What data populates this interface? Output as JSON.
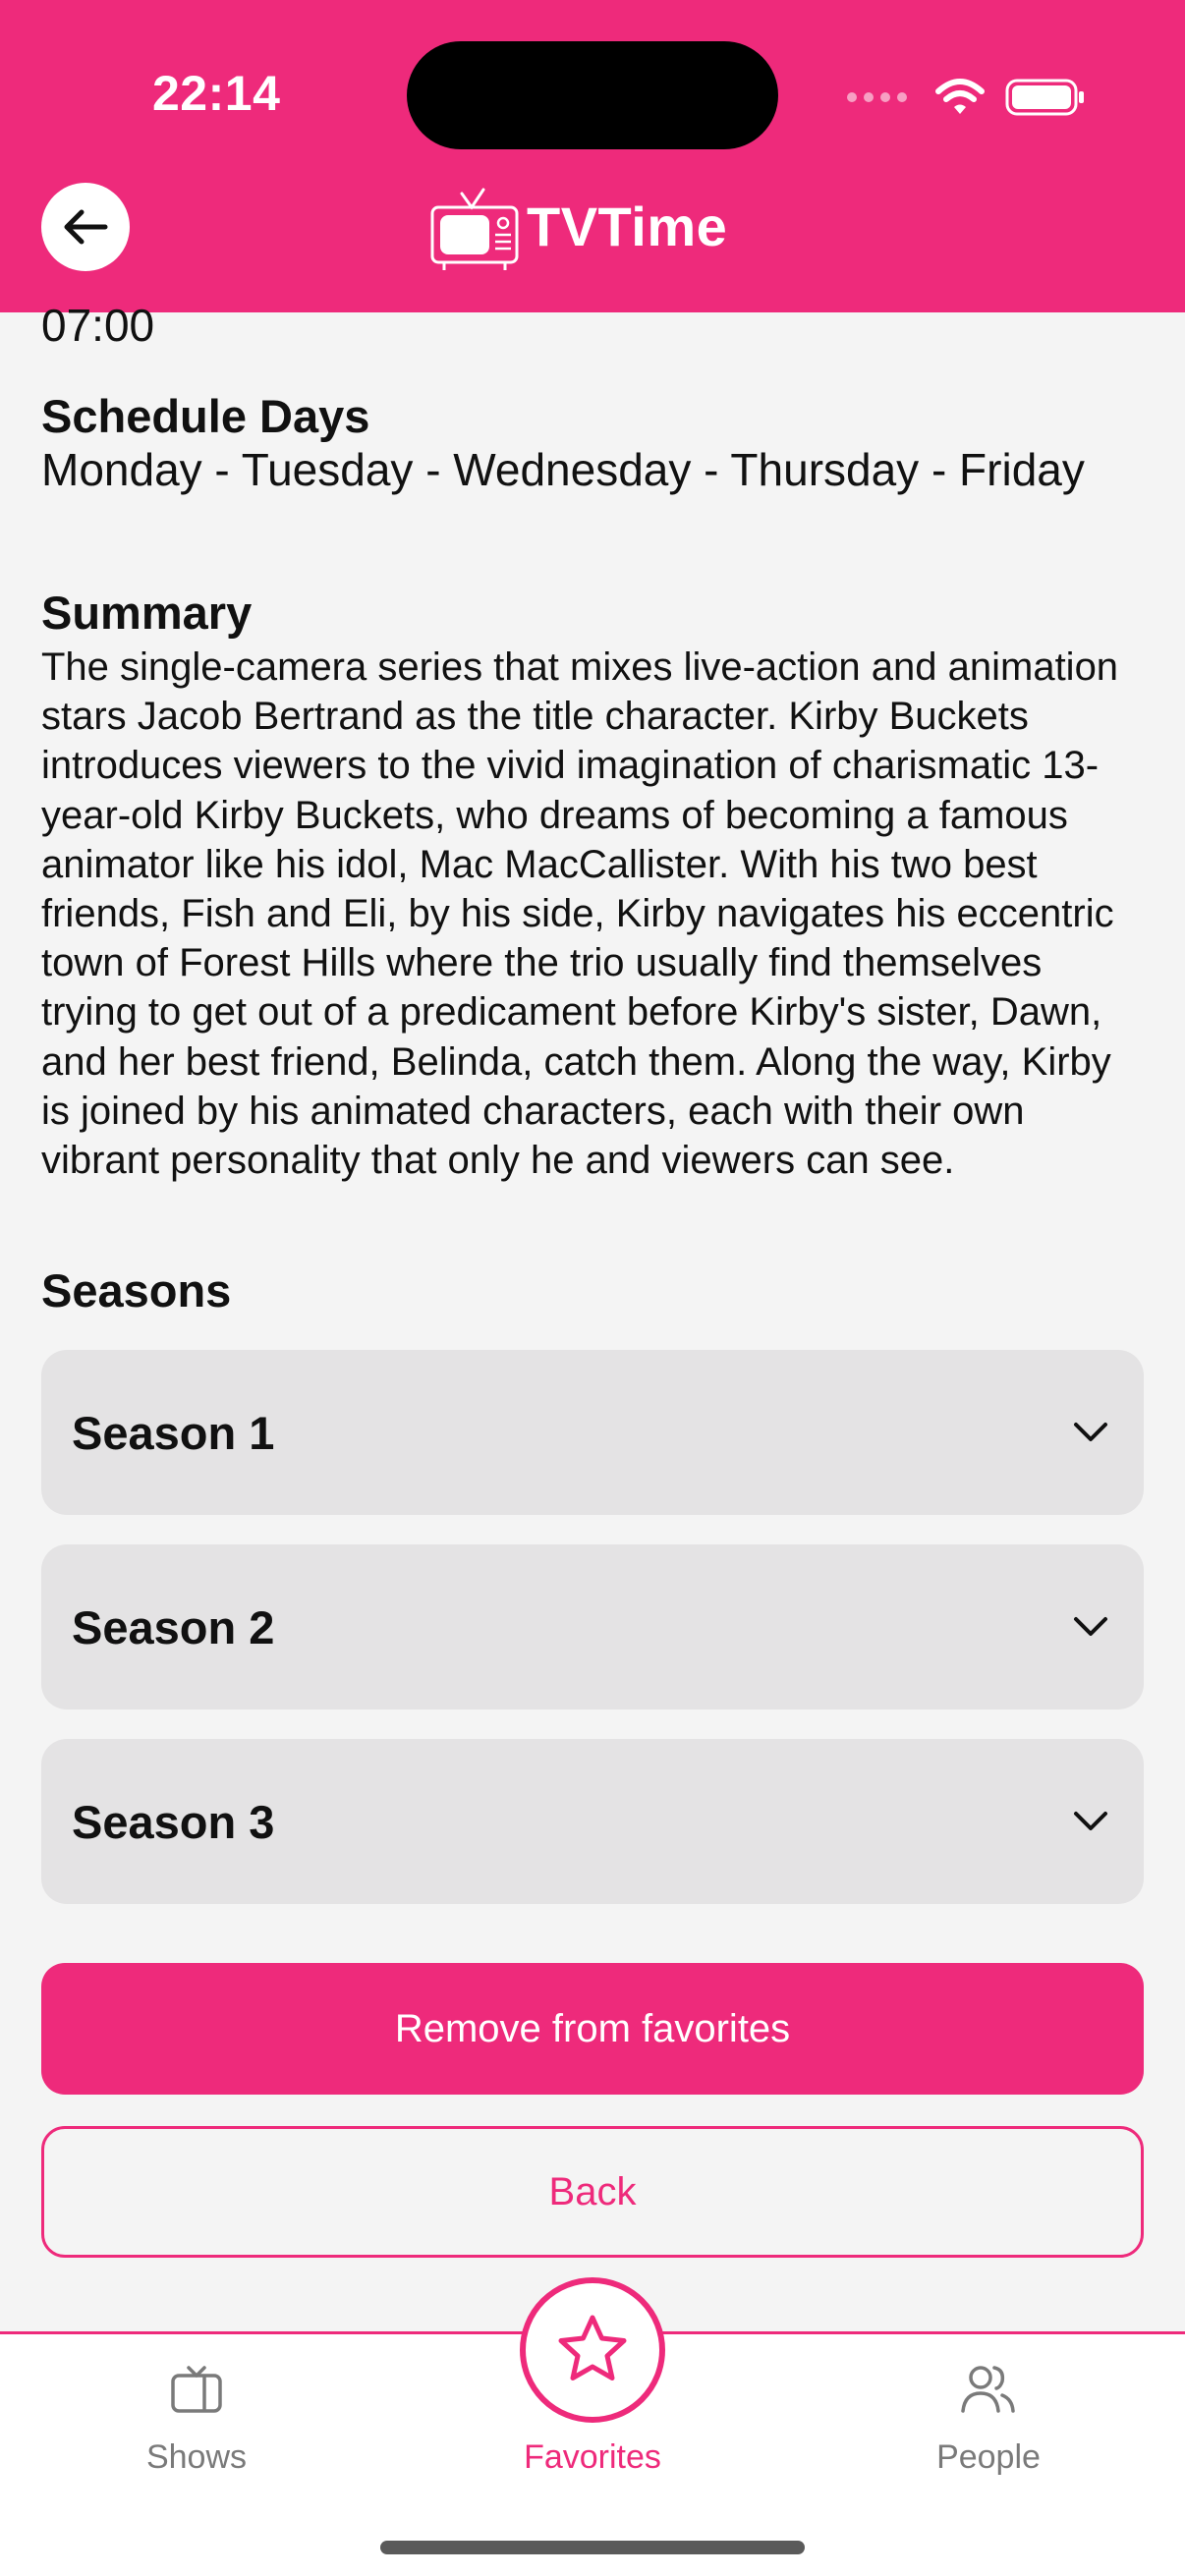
{
  "status_bar": {
    "time": "22:14"
  },
  "header": {
    "app_name": "TVTime"
  },
  "show": {
    "time_value": "07:00",
    "schedule_label": "Schedule Days",
    "schedule_value": "Monday - Tuesday - Wednesday - Thursday - Friday",
    "summary_label": "Summary",
    "summary_text": "The single-camera series that mixes live-action and animation stars Jacob Bertrand as the title character. Kirby Buckets introduces viewers to the vivid imagination of charismatic 13-year-old Kirby Buckets, who dreams of becoming a famous animator like his idol, Mac MacCallister. With his two best friends, Fish and Eli, by his side, Kirby navigates his eccentric town of Forest Hills where the trio usually find themselves trying to get out of a predicament before Kirby's sister, Dawn, and her best friend, Belinda, catch them. Along the way, Kirby is joined by his animated characters, each with their own vibrant personality that only he and viewers can see.",
    "seasons_label": "Seasons",
    "seasons": [
      {
        "label": "Season 1"
      },
      {
        "label": "Season 2"
      },
      {
        "label": "Season 3"
      }
    ]
  },
  "actions": {
    "remove_label": "Remove from favorites",
    "back_label": "Back"
  },
  "tabbar": {
    "shows_label": "Shows",
    "favorites_label": "Favorites",
    "people_label": "People"
  },
  "colors": {
    "accent": "#ee2a7b",
    "card": "#e4e3e4",
    "background": "#f4f4f4"
  },
  "icons": [
    "back-arrow-icon",
    "tv-logo-icon",
    "chevron-down-icon",
    "tv-icon",
    "star-icon",
    "people-icon",
    "wifi-icon",
    "battery-icon"
  ]
}
